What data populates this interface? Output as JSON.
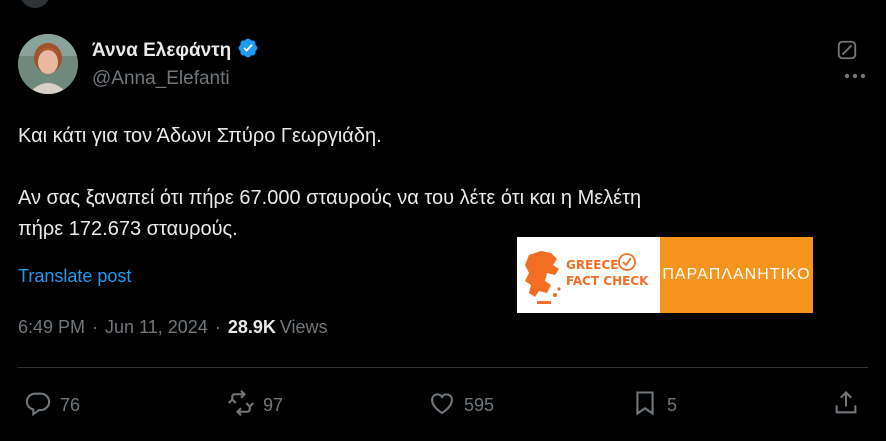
{
  "author": {
    "name": "Άννα Ελεφάντη",
    "handle": "@Anna_Elefanti"
  },
  "post": {
    "line1": "Και κάτι για τον Άδωνι Σπύρο Γεωργιάδη.",
    "line2": "Αν σας ξαναπεί ότι πήρε 67.000 σταυρούς να του λέτε ότι και η Μελέτη",
    "line3": "πήρε 172.673 σταυρούς.",
    "translate_label": "Translate post"
  },
  "fact_check_card": {
    "logo_line1": "GREECE",
    "logo_line2": "FACT CHECK",
    "verdict": "ΠΑΡΑΠΛΑΝΗΤΙΚΟ",
    "logo_color": "#f26e22",
    "verdict_bg": "#f7941d"
  },
  "meta": {
    "time": "6:49 PM",
    "sep1": "·",
    "date": "Jun 11, 2024",
    "sep2": "·",
    "views_count": "28.9K",
    "views_label": "Views"
  },
  "actions": {
    "replies": "76",
    "reposts": "97",
    "likes": "595",
    "bookmarks": "5"
  },
  "icons": [
    "verified-badge-icon",
    "grok-icon",
    "more-icon",
    "reply-icon",
    "repost-icon",
    "like-icon",
    "bookmark-icon",
    "share-icon"
  ],
  "colors": {
    "accent": "#1d9bf0",
    "muted": "#71767b",
    "text": "#e7e9ea",
    "background": "#000000"
  }
}
